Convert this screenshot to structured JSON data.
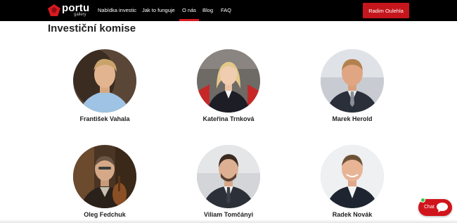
{
  "brand": {
    "name": "portu",
    "sub": "gallery",
    "accent": "#c4161c"
  },
  "nav": {
    "items": [
      {
        "label": "Nabídka investic"
      },
      {
        "label": "Jak to funguje"
      },
      {
        "label": "O nás"
      },
      {
        "label": "Blog"
      },
      {
        "label": "FAQ"
      }
    ],
    "active": "O nás",
    "user_button": "Radim Oulehla"
  },
  "section": {
    "title": "Investiční komise"
  },
  "members": [
    {
      "name": "František Vahala"
    },
    {
      "name": "Kateřina Trnková"
    },
    {
      "name": "Marek Herold"
    },
    {
      "name": "Oleg Fedchuk"
    },
    {
      "name": "Viliam Tomčányi"
    },
    {
      "name": "Radek Novák"
    }
  ],
  "chat": {
    "label": "Chat"
  }
}
